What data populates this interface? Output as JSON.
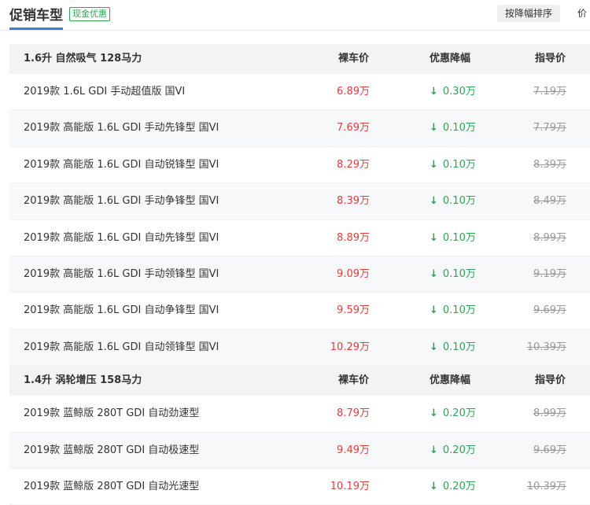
{
  "header": {
    "title": "促销车型",
    "badge": "现金优惠",
    "sort_label": "按降幅排序",
    "more": "价"
  },
  "colors": {
    "accent": "#3a7fd5",
    "price": "#e03d3d",
    "drop": "#2ea356",
    "muted": "#999999"
  },
  "groups": [
    {
      "name": "1.6升 自然吸气 128马力",
      "col_price": "裸车价",
      "col_drop": "优惠降幅",
      "col_guide": "指导价",
      "rows": [
        {
          "name": "2019款 1.6L GDI 手动超值版 国VI",
          "price": "6.89万",
          "drop": "0.30万",
          "guide": "7.19万"
        },
        {
          "name": "2019款 高能版 1.6L GDI 手动先锋型 国VI",
          "price": "7.69万",
          "drop": "0.10万",
          "guide": "7.79万"
        },
        {
          "name": "2019款 高能版 1.6L GDI 自动锐锋型 国VI",
          "price": "8.29万",
          "drop": "0.10万",
          "guide": "8.39万"
        },
        {
          "name": "2019款 高能版 1.6L GDI 手动争锋型 国VI",
          "price": "8.39万",
          "drop": "0.10万",
          "guide": "8.49万"
        },
        {
          "name": "2019款 高能版 1.6L GDI 自动先锋型 国VI",
          "price": "8.89万",
          "drop": "0.10万",
          "guide": "8.99万"
        },
        {
          "name": "2019款 高能版 1.6L GDI 手动领锋型 国VI",
          "price": "9.09万",
          "drop": "0.10万",
          "guide": "9.19万"
        },
        {
          "name": "2019款 高能版 1.6L GDI 自动争锋型 国VI",
          "price": "9.59万",
          "drop": "0.10万",
          "guide": "9.69万"
        },
        {
          "name": "2019款 高能版 1.6L GDI 自动领锋型 国VI",
          "price": "10.29万",
          "drop": "0.10万",
          "guide": "10.39万"
        }
      ]
    },
    {
      "name": "1.4升 涡轮增压 158马力",
      "col_price": "裸车价",
      "col_drop": "优惠降幅",
      "col_guide": "指导价",
      "rows": [
        {
          "name": "2019款 蓝鲸版 280T GDI 自动劲速型",
          "price": "8.79万",
          "drop": "0.20万",
          "guide": "8.99万"
        },
        {
          "name": "2019款 蓝鲸版 280T GDI 自动极速型",
          "price": "9.49万",
          "drop": "0.20万",
          "guide": "9.69万"
        },
        {
          "name": "2019款 蓝鲸版 280T GDI 自动光速型",
          "price": "10.19万",
          "drop": "0.20万",
          "guide": "10.39万"
        }
      ]
    }
  ]
}
